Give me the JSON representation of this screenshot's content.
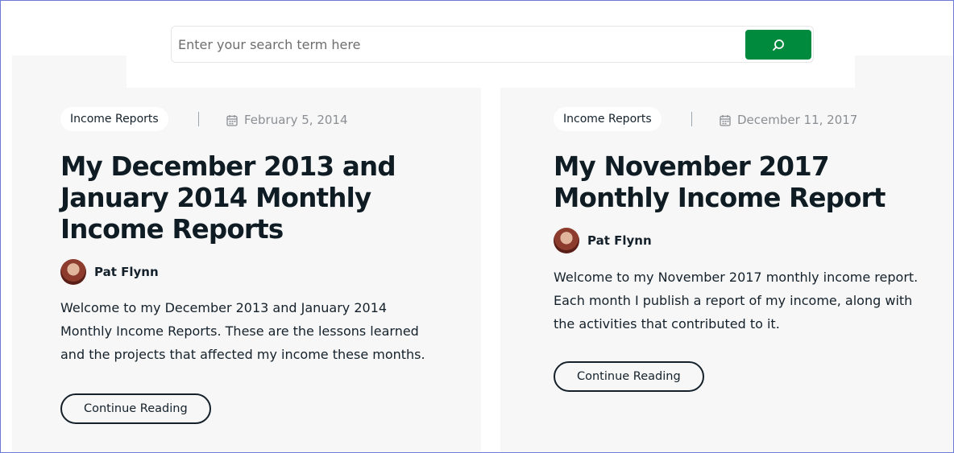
{
  "search": {
    "placeholder": "Enter your search term here",
    "button_icon": "search-icon",
    "button_color": "#008a3e"
  },
  "posts": [
    {
      "category": "Income Reports",
      "date": "February 5, 2014",
      "title": "My December 2013 and January 2014 Monthly Income Reports",
      "author": "Pat Flynn",
      "excerpt": "Welcome to my December 2013 and January 2014 Monthly Income Reports. These are the lessons learned and the projects that affected my income these months.",
      "cta": "Continue Reading"
    },
    {
      "category": "Income Reports",
      "date": "December 11, 2017",
      "title": "My November 2017 Monthly Income Report",
      "author": "Pat Flynn",
      "excerpt": "Welcome to my November 2017 monthly income report. Each month I publish a report of my income, along with the activities that contributed to it.",
      "cta": "Continue Reading"
    }
  ]
}
